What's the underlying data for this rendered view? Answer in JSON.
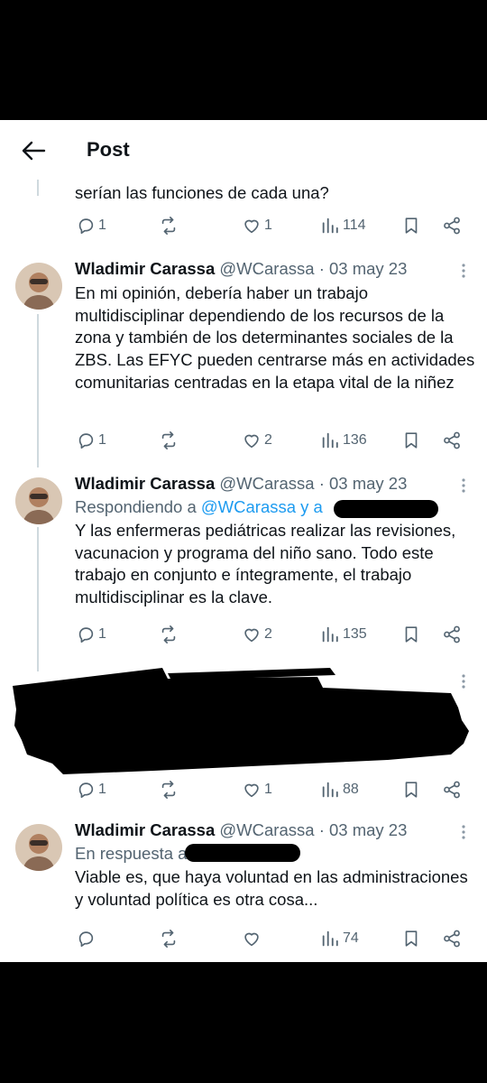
{
  "header": {
    "title": "Post"
  },
  "posts": [
    {
      "body": "serían las funciones de cada una?",
      "stats": {
        "replies": "1",
        "reposts": "",
        "likes": "1",
        "views": "114"
      }
    },
    {
      "name": "Wladimir Carassa",
      "handle": "@WCarassa",
      "sep": "·",
      "date": "03 may 23",
      "body": "En mi opinión, debería haber un trabajo multidisciplinar dependiendo de los recursos de la zona y también de los determinantes sociales de la ZBS. Las EFYC pueden centrarse más en actividades comunitarias centradas en la etapa vital de la niñez",
      "stats": {
        "replies": "1",
        "reposts": "",
        "likes": "2",
        "views": "136"
      }
    },
    {
      "name": "Wladimir Carassa",
      "handle": "@WCarassa",
      "sep": "·",
      "date": "03 may 23",
      "reply_prefix": "Respondiendo a ",
      "reply_target": "@WCarassa y a",
      "body": "Y las enfermeras pediátricas realizar las revisiones, vacunacion y programa del niño sano. Todo este trabajo en conjunto e íntegramente, el trabajo multidisciplinar es la clave.",
      "stats": {
        "replies": "1",
        "reposts": "",
        "likes": "2",
        "views": "135"
      }
    },
    {
      "stats": {
        "replies": "1",
        "reposts": "",
        "likes": "1",
        "views": "88"
      }
    },
    {
      "name": "Wladimir Carassa",
      "handle": "@WCarassa",
      "sep": "·",
      "date": "03 may 23",
      "reply_prefix": "En respuesta a",
      "body": "Viable es, que haya voluntad en las administraciones y voluntad política es otra cosa...",
      "stats": {
        "replies": "",
        "reposts": "",
        "likes": "",
        "views": "74"
      }
    }
  ],
  "colors": {
    "text": "#0f1419",
    "muted": "#536471",
    "link": "#1d9bf0",
    "line": "#cfd9de"
  }
}
